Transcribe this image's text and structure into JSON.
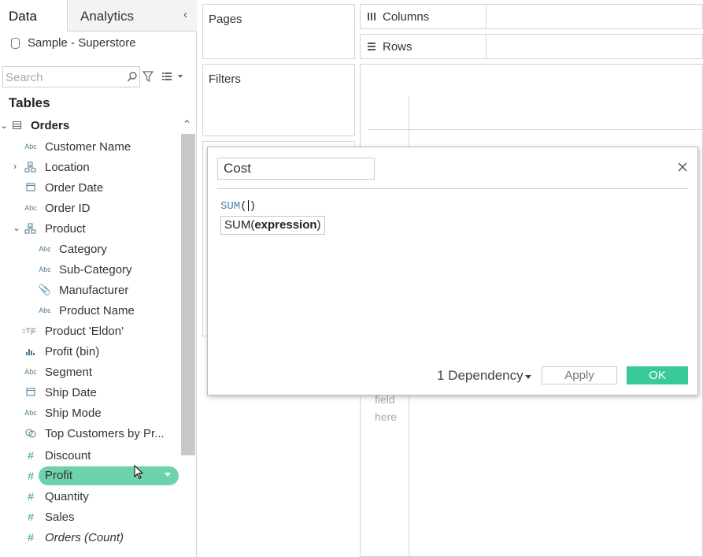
{
  "tabs": {
    "data_label": "Data",
    "analytics_label": "Analytics"
  },
  "data_source": {
    "name": "Sample - Superstore"
  },
  "search": {
    "placeholder": "Search"
  },
  "tables": {
    "title": "Tables",
    "orders_label": "Orders",
    "fields": [
      {
        "label": "Customer Name",
        "icon": "Abc"
      },
      {
        "label": "Location",
        "icon": "hierarchy"
      },
      {
        "label": "Order Date",
        "icon": "calendar"
      },
      {
        "label": "Order ID",
        "icon": "Abc"
      },
      {
        "label": "Product",
        "icon": "hierarchy"
      },
      {
        "label": "Category",
        "icon": "Abc"
      },
      {
        "label": "Sub-Category",
        "icon": "Abc"
      },
      {
        "label": "Manufacturer",
        "icon": "paperclip"
      },
      {
        "label": "Product Name",
        "icon": "Abc"
      },
      {
        "label": "Product 'Eldon'",
        "icon": "=T|F"
      },
      {
        "label": "Profit (bin)",
        "icon": "histogram"
      },
      {
        "label": "Segment",
        "icon": "Abc"
      },
      {
        "label": "Ship Date",
        "icon": "calendar"
      },
      {
        "label": "Ship Mode",
        "icon": "Abc"
      },
      {
        "label": "Top Customers by Pr...",
        "icon": "set"
      },
      {
        "label": "Discount",
        "icon": "#"
      },
      {
        "label": "Profit",
        "icon": "#"
      },
      {
        "label": "Quantity",
        "icon": "#"
      },
      {
        "label": "Sales",
        "icon": "#"
      },
      {
        "label": "Orders (Count)",
        "icon": "#"
      }
    ]
  },
  "shelves": {
    "pages": "Pages",
    "filters": "Filters",
    "columns": "Columns",
    "rows": "Rows"
  },
  "viz": {
    "drop_hint_line1": "field",
    "drop_hint_line2": "here"
  },
  "calc": {
    "name": "Cost",
    "formula_func": "SUM",
    "formula_open": "(",
    "formula_close": ")",
    "tooltip_func": "SUM(",
    "tooltip_arg": "expression",
    "tooltip_close": ")",
    "dependency": "1 Dependency",
    "apply_label": "Apply",
    "ok_label": "OK"
  },
  "colors": {
    "measure_green": "#3ac99a",
    "pill_green": "#6ed3ac",
    "dimension_blue": "#4d7a91"
  }
}
